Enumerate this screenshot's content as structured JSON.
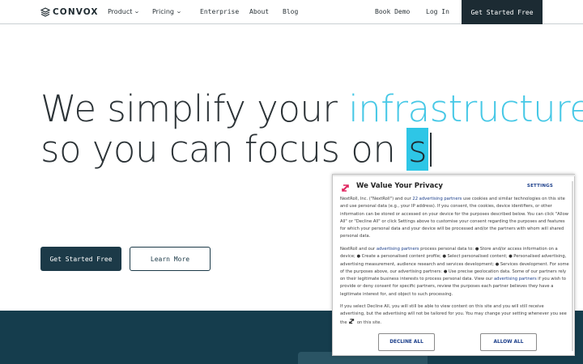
{
  "nav": {
    "logo_text": "CONVOX",
    "items": [
      {
        "label": "Product",
        "has_menu": true
      },
      {
        "label": "Pricing",
        "has_menu": true
      },
      {
        "label": "Enterprise",
        "has_menu": false
      },
      {
        "label": "About",
        "has_menu": false
      },
      {
        "label": "Blog",
        "has_menu": false
      }
    ],
    "book_demo": "Book Demo",
    "login": "Log In",
    "cta": "Get Started Free"
  },
  "hero": {
    "line1_plain": "We simplify your ",
    "line1_accent": "infrastructure",
    "line2_plain": "so you can focus on ",
    "line2_typed": "s",
    "primary_button": "Get Started Free",
    "secondary_button": "Learn More"
  },
  "consent": {
    "title": "We Value Your Privacy",
    "settings_label": "SETTINGS",
    "p1_a": "NextRoll, Inc. (\"NextRoll\") and our ",
    "p1_link": "22 advertising partners",
    "p1_b": " use cookies and similar technologies on this site and use personal data (e.g., your IP address). If you consent, the cookies, device identifiers, or other information can be stored or accessed on your device for the purposes described below. You can click \"Allow All\" or \"Decline All\" or click Settings above to customise your consent regarding the purposes and features for which your personal data and your device will be processed and/or the partners with whom will shared personal data.",
    "p2_a": "NextRoll and our ",
    "p2_link": "advertising partners",
    "p2_b": " process personal data to: ",
    "p2_c": " Store and/or access information on a device; ",
    "p2_d": " Create a personalised content profile; ",
    "p2_e": " Select personalised content; ",
    "p2_f": " Personalised advertising, advertising measurement, audience research and services development; ",
    "p2_g": " Services development. For some of the purposes above, our advertising partners: ",
    "p2_h": " Use precise geolocation data. Some of our partners rely on their legitimate business interests to process personal data. View our ",
    "p2_link2": "advertising partners",
    "p2_i": " if you wish to provide or deny consent for specific partners, review the purposes each partner believes they have a legitimate interest for, and object to such processing.",
    "p3_a": "If you select Decline All, you will still be able to view content on this site and you will still receive advertising, but the advertising will not be tailored for you. You may change your setting whenever you see the ",
    "p3_b": " on this site.",
    "decline_label": "DECLINE ALL",
    "allow_label": "ALLOW ALL"
  },
  "colors": {
    "accent": "#46c8e6",
    "dark": "#1c2b33",
    "band": "#153d4d",
    "link": "#1b3e8a"
  },
  "icons": {
    "logo": "stacked-layers-icon",
    "chevron": "chevron-down-icon",
    "consent_logo": "nextroll-logo-icon"
  }
}
